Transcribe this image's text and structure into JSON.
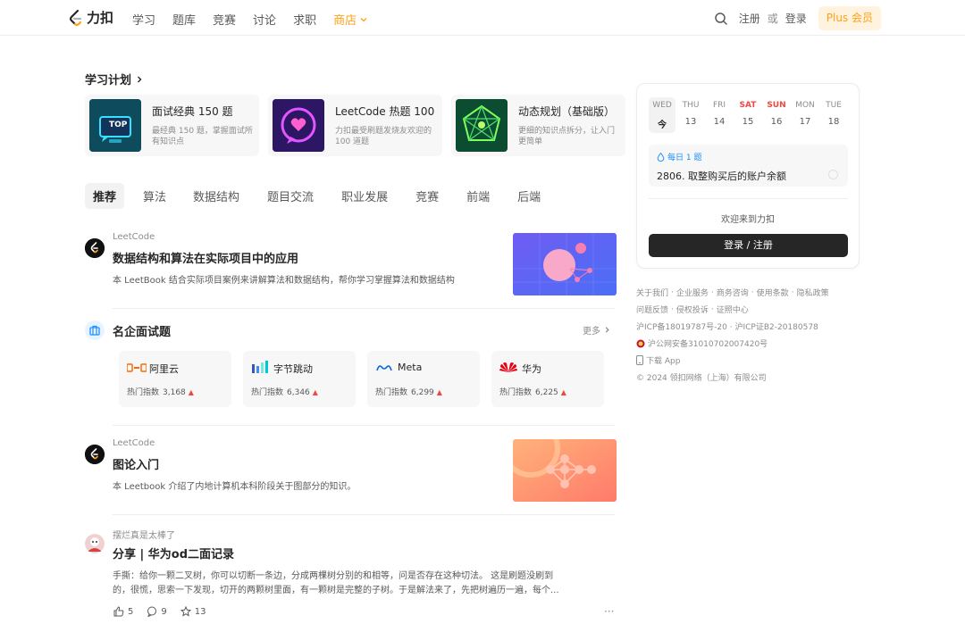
{
  "nav": {
    "logo_text": "力扣",
    "items": [
      "学习",
      "题库",
      "竞赛",
      "讨论",
      "求职",
      "商店"
    ],
    "register": "注册",
    "or": "或",
    "login": "登录",
    "plus": "Plus 会员",
    "accent": "#ffa116"
  },
  "study_plan": {
    "title": "学习计划",
    "cards": [
      {
        "name": "面试经典 150 题",
        "desc": "最经典 150 题，掌握面试所有知识点"
      },
      {
        "name": "LeetCode 热题 100",
        "desc": "力扣最受刷题发烧友欢迎的 100 道题"
      },
      {
        "name": "动态规划（基础版）",
        "desc": "更细的知识点拆分，让入门更简单"
      }
    ],
    "thumb_labels": {
      "top": "TOP"
    }
  },
  "tabs": [
    "推荐",
    "算法",
    "数据结构",
    "题目交流",
    "职业发展",
    "竞赛",
    "前端",
    "后端"
  ],
  "feed": {
    "post1": {
      "author": "LeetCode",
      "title": "数据结构和算法在实际项目中的应用",
      "desc": "本 LeetBook 结合实际项目案例来讲解算法和数据结构，帮你学习掌握算法和数据结构"
    },
    "companies": {
      "title": "名企面试题",
      "more": "更多",
      "hot_label": "热门指数",
      "items": [
        {
          "name": "阿里云",
          "hot": "3,168"
        },
        {
          "name": "字节跳动",
          "hot": "6,346"
        },
        {
          "name": "Meta",
          "hot": "6,299"
        },
        {
          "name": "华为",
          "hot": "6,225"
        }
      ]
    },
    "post2": {
      "author": "LeetCode",
      "title": "图论入门",
      "desc": "本 Leetbook 介绍了内地计算机本科阶段关于图部分的知识。"
    },
    "post3": {
      "author": "摆烂真是太棒了",
      "title": "分享 | 华为od二面记录",
      "desc_line1": "手撕：给你一颗二叉树，你可以切断一条边，分成两棵树分别的和相等，问是否存在这种切法。 这是刷题没刷到",
      "desc_line2": "的，很慌，思索一下发现，切开的两颗树里面，有一颗树是完整的子树。于是解法来了，先把树遍历一遍，每个...",
      "likes": "5",
      "comments": "9",
      "stars": "13",
      "more_dots": "···"
    }
  },
  "sidebar": {
    "calendar": [
      {
        "day": "WED",
        "date": "今"
      },
      {
        "day": "THU",
        "date": "13"
      },
      {
        "day": "FRI",
        "date": "14"
      },
      {
        "day": "SAT",
        "date": "15"
      },
      {
        "day": "SUN",
        "date": "16"
      },
      {
        "day": "MON",
        "date": "17"
      },
      {
        "day": "TUE",
        "date": "18"
      }
    ],
    "daily_label": "每日 1 题",
    "daily_question": "2806. 取整购买后的账户余额",
    "welcome": "欢迎来到力扣",
    "login_button": "登录 / 注册"
  },
  "footer": {
    "line1": [
      "关于我们",
      "企业服务",
      "商务咨询",
      "使用条款",
      "隐私政策"
    ],
    "line2": [
      "问题反馈",
      "侵权投诉",
      "证照中心"
    ],
    "icp": "沪ICP备18019787号-20 · 沪ICP证B2-20180578",
    "police": "沪公网安备31010702007420号",
    "download": "下载 App",
    "copyright": "© 2024 领扣网络（上海）有限公司"
  }
}
